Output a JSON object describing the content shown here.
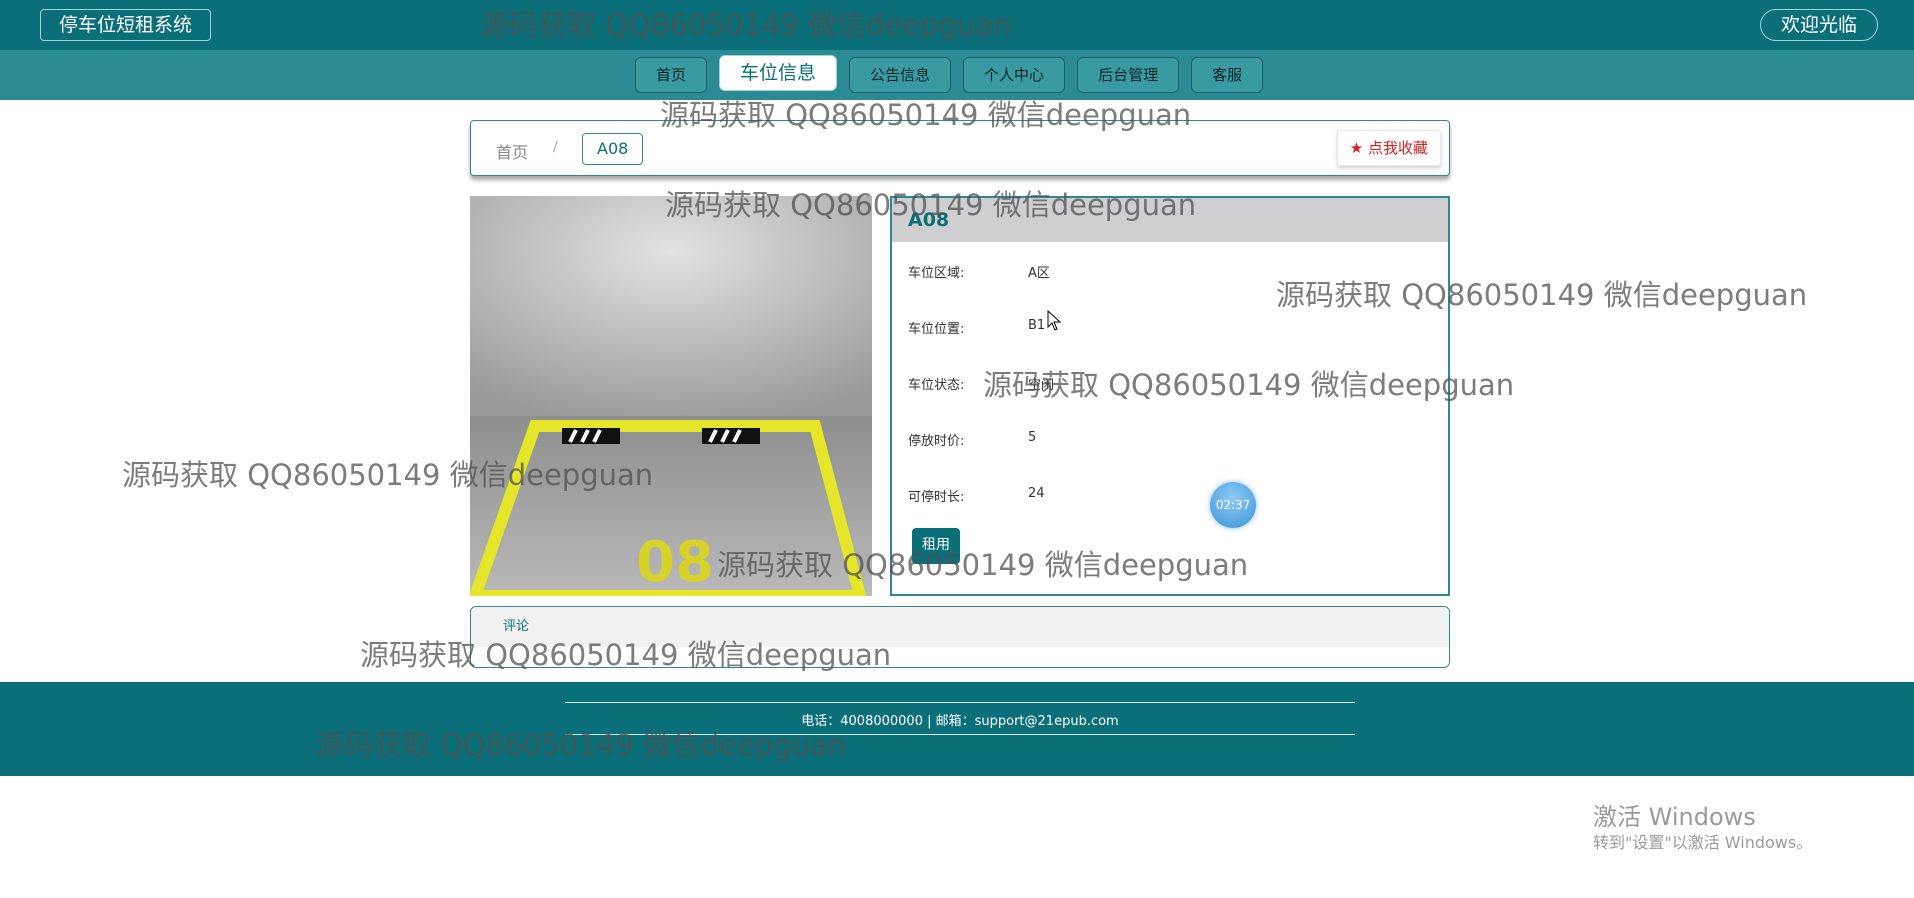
{
  "header": {
    "brand": "停车位短租系统",
    "welcome": "欢迎光临"
  },
  "nav": {
    "items": [
      "首页",
      "车位信息",
      "公告信息",
      "个人中心",
      "后台管理",
      "客服"
    ],
    "active_index": 1
  },
  "breadcrumb": {
    "home": "首页",
    "separator": "/",
    "current": "A08"
  },
  "favorite_button": "点我收藏",
  "detail": {
    "title": "A08",
    "fields": [
      {
        "label": "车位区域:",
        "value": "A区"
      },
      {
        "label": "车位位置:",
        "value": "B1"
      },
      {
        "label": "车位状态:",
        "value": "空闲"
      },
      {
        "label": "停放时价:",
        "value": "5"
      },
      {
        "label": "可停时长:",
        "value": "24"
      }
    ],
    "rent_button": "租用"
  },
  "photo": {
    "number": "08"
  },
  "timer": "02:37",
  "comments": {
    "tab": "评论"
  },
  "footer": {
    "text": "电话：4008000000 | 邮箱：support@21epub.com"
  },
  "watermark": "源码获取 QQ86050149 微信deepguan",
  "windows_activation": {
    "title": "激活 Windows",
    "subtitle": "转到\"设置\"以激活 Windows。"
  },
  "colors": {
    "primary": "#0b6f7a",
    "nav_bg": "#2b8a93",
    "favorite": "#d62020",
    "timer": "#3c94d8"
  }
}
